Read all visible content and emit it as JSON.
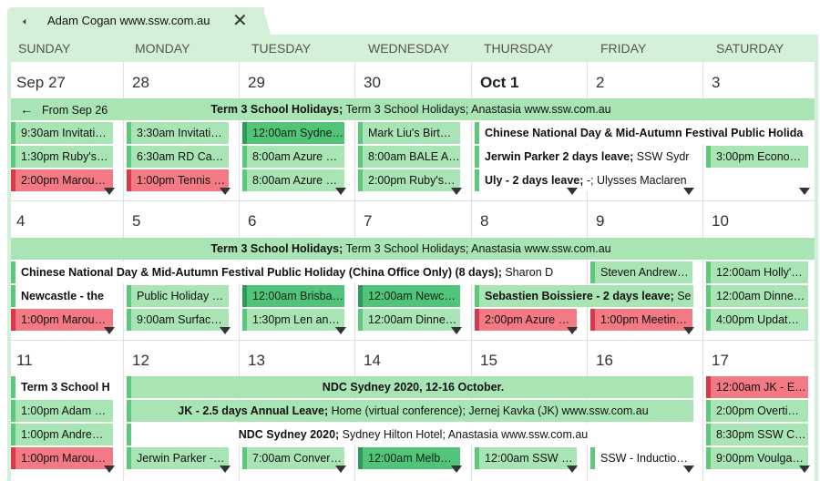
{
  "tab": {
    "title": "Adam Cogan www.ssw.com.au"
  },
  "days": [
    "SUNDAY",
    "MONDAY",
    "TUESDAY",
    "WEDNESDAY",
    "THURSDAY",
    "FRIDAY",
    "SATURDAY"
  ],
  "week1": {
    "dates": [
      "Sep 27",
      "28",
      "29",
      "30",
      "Oct 1",
      "2",
      "3"
    ],
    "span1_from": "From Sep 26",
    "span1_bold": "Term 3 School Holidays;",
    "span1_rest": " Term 3 School Holidays; Anastasia www.ssw.com.au",
    "sun": [
      "9:30am Invitati…",
      "1:30pm Ruby's…",
      "2:00pm Marou…"
    ],
    "mon": [
      "3:30am Invitati…",
      "6:30am  RD Ca…",
      "1:00pm Tennis …"
    ],
    "tue": [
      "12:00am Sydne…",
      "8:00am Azure …",
      "8:00am Azure …"
    ],
    "wed": [
      "Mark Liu's Birt…",
      "8:00am BALE A…",
      "2:00pm Ruby's…"
    ],
    "thu_r1_bold": "Chinese National Day & Mid-Autumn Festival Public Holida",
    "thu_r2_bold": "Jerwin Parker 2 days leave;",
    "thu_r2_rest": " SSW Sydr",
    "thu_r3_bold": "Uly - 2 days leave;",
    "thu_r3_rest": " -; Ulysses Maclaren",
    "sat": [
      "3:00pm Econo…"
    ]
  },
  "week2": {
    "dates": [
      "4",
      "5",
      "6",
      "7",
      "8",
      "9",
      "10"
    ],
    "span1_bold": "Term 3 School Holidays;",
    "span1_rest": " Term 3 School Holidays; Anastasia www.ssw.com.au",
    "span2_bold": "Chinese National Day & Mid-Autumn Festival Public Holiday (China Office Only) (8 days);",
    "span2_rest": " Sharon D",
    "fri_r2": "Steven Andrew…",
    "sun": [
      "Newcastle - the",
      "1:00pm Marou…"
    ],
    "mon": [
      "Public Holiday …",
      "9:00am Surfac…"
    ],
    "tue": [
      "12:00am Brisba…",
      "1:30pm Len an…"
    ],
    "wed": [
      "12:00am Newc…",
      "12:00am Dinne…"
    ],
    "thu_bold": "Sebastien Boissiere - 2 days leave;",
    "thu_rest": " Se",
    "thu_r4": "2:00pm Azure …",
    "fri_r4": "1:00pm Meetin…",
    "sat": [
      "12:00am Holly'…",
      "12:00am Dinne…",
      "4:00pm Updat…"
    ]
  },
  "week3": {
    "dates": [
      "11",
      "12",
      "13",
      "14",
      "15",
      "16",
      "17"
    ],
    "sun": [
      "Term 3 School H",
      "1:00pm Adam …",
      "1:00pm Andre…",
      "1:00pm Marou…"
    ],
    "span1": "NDC Sydney 2020, 12-16 October.",
    "span2_bold": "JK - 2.5 days Annual Leave;",
    "span2_rest": " Home (virtual conference); Jernej Kavka (JK) www.ssw.com.au",
    "span3_bold": "NDC Sydney 2020;",
    "span3_rest": " Sydney Hilton Hotel; Anastasia www.ssw.com.au",
    "mon_r4": "Jerwin Parker -…",
    "tue_r4": "7:00am Conver…",
    "wed_r4": "12:00am Melb…",
    "thu_r4": "12:00am SSW …",
    "fri_r4": "SSW - Inductio…",
    "sat": [
      "12:00am JK - E…",
      "2:00pm Overti…",
      "8:30pm SSW C…",
      "9:00pm Voulga…"
    ]
  },
  "colors": {
    "light_green": "#a8e4b4",
    "dark_green": "#52c47a",
    "red": "#f37a85",
    "header": "#d4f0d8"
  }
}
